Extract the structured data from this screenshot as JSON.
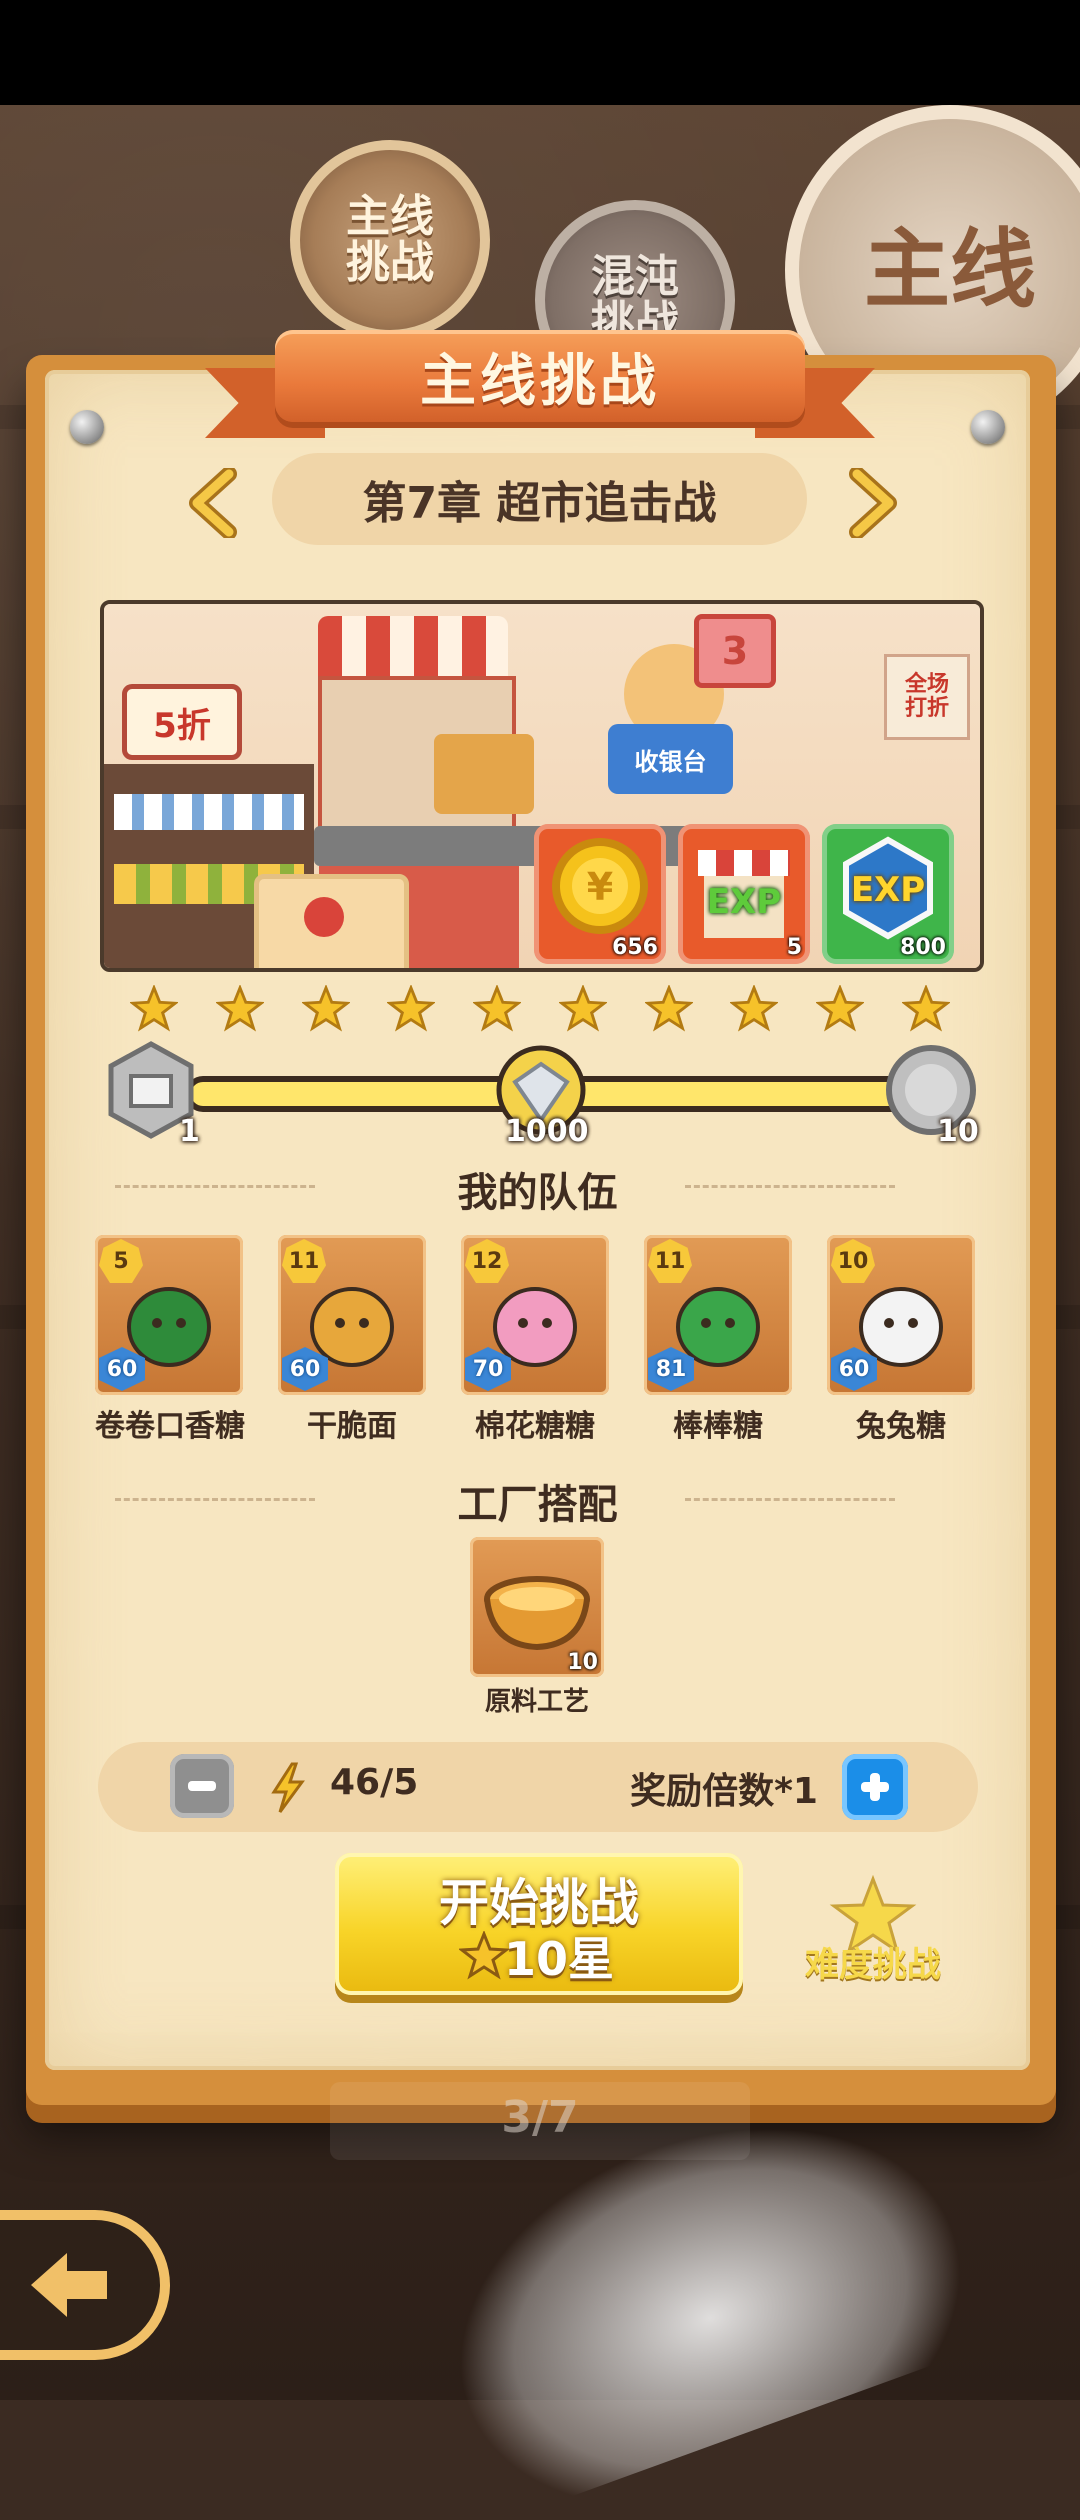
{
  "colors": {
    "panel": "#f7e6c1",
    "ribbon": "#e9793b",
    "accent_yellow": "#f8d428",
    "plus_blue": "#1b8ee8",
    "text_dark": "#3f2c20"
  },
  "background_tokens": {
    "main": "主线\n挑战",
    "chaos": "混沌\n挑战",
    "big": "主线"
  },
  "header": {
    "title": "主线挑战",
    "chapter": "第7章 超市追击战"
  },
  "scene": {
    "sign_sale": "5折",
    "sign_cashier": "收银台",
    "sign_number": "3",
    "sign_wall": "全场\n打折"
  },
  "rewards": [
    {
      "icon": "gold-coin-icon",
      "label": "",
      "qty": "656"
    },
    {
      "icon": "exp-shop-icon",
      "label": "EXP",
      "qty": "5"
    },
    {
      "icon": "exp-gem-icon",
      "label": "EXP",
      "qty": "800"
    }
  ],
  "stars": {
    "count": 10
  },
  "progress": {
    "value_fraction": 0.95,
    "milestones": [
      {
        "label": "1",
        "icon": "box-icon"
      },
      {
        "label": "1000",
        "icon": "diamond-icon"
      },
      {
        "label": "10",
        "icon": "reward-coin-icon"
      }
    ]
  },
  "team": {
    "title": "我的队伍",
    "members": [
      {
        "name": "卷卷口香糖",
        "level": "5",
        "power": "60",
        "color": "#2e8b3a"
      },
      {
        "name": "干脆面",
        "level": "11",
        "power": "60",
        "color": "#e7a73b"
      },
      {
        "name": "棉花糖糖",
        "level": "12",
        "power": "70",
        "color": "#f29cc0"
      },
      {
        "name": "棒棒糖",
        "level": "11",
        "power": "81",
        "color": "#3aa64a"
      },
      {
        "name": "兔兔糖",
        "level": "10",
        "power": "60",
        "color": "#f3f3f3"
      }
    ]
  },
  "factory": {
    "title": "工厂搭配",
    "item_name": "原料工艺",
    "item_qty": "10"
  },
  "multiplier": {
    "energy": "46/5",
    "reward_text": "奖励倍数*1"
  },
  "start_button": {
    "line1": "开始挑战",
    "line2": "10星"
  },
  "difficulty_label": "难度挑战",
  "page_indicator": "3/7"
}
